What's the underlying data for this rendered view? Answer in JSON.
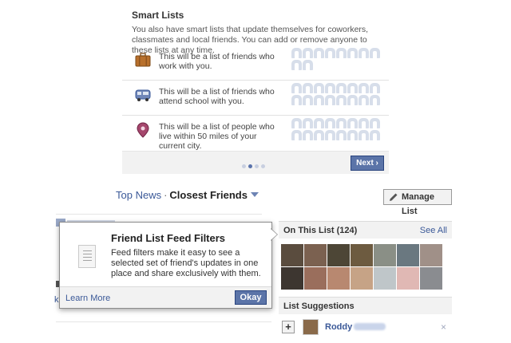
{
  "smart_lists": {
    "title": "Smart Lists",
    "description": "You also have smart lists that update themselves for coworkers, classmates and local friends. You can add or remove anyone to these lists at any time.",
    "rows": [
      {
        "icon": "briefcase-icon",
        "text": "This will be a list of friends who work with you."
      },
      {
        "icon": "school-bus-icon",
        "text": "This will be a list of friends who attend school with you."
      },
      {
        "icon": "map-pin-icon",
        "text": "This will be a list of people who live within 50 miles of your current city."
      }
    ],
    "pager": {
      "count": 4,
      "active_index": 1
    },
    "next_label": "Next ›"
  },
  "header": {
    "breadcrumb_parent": "Top News",
    "separator": "·",
    "current": "Closest Friends",
    "manage_label": "Manage List"
  },
  "popup": {
    "title": "Friend List Feed Filters",
    "body": "Feed filters make it easy to see a selected set of friend's updates in one place and share exclusively with them.",
    "learn_more": "Learn More",
    "okay": "Okay"
  },
  "feed": {
    "partial_text": "k",
    "partial_glyph": "n"
  },
  "on_this_list": {
    "label": "On This List (124)",
    "see_all": "See All",
    "photo_colors": [
      "#5a4c3e",
      "#7b6150",
      "#4d4636",
      "#6d5b40",
      "#8a8f86",
      "#6a7880",
      "#a09088",
      "#3d3630",
      "#9a6e5c",
      "#b88870",
      "#c6a386",
      "#bfc6c9",
      "#e0b8b4",
      "#8a8c90"
    ]
  },
  "list_suggestions": {
    "label": "List Suggestions",
    "add_symbol": "+",
    "name": "Roddy",
    "close_symbol": "×"
  },
  "colors": {
    "link": "#3b5998",
    "button_blue": "#5b74a8",
    "placeholder": "#d7deea"
  }
}
